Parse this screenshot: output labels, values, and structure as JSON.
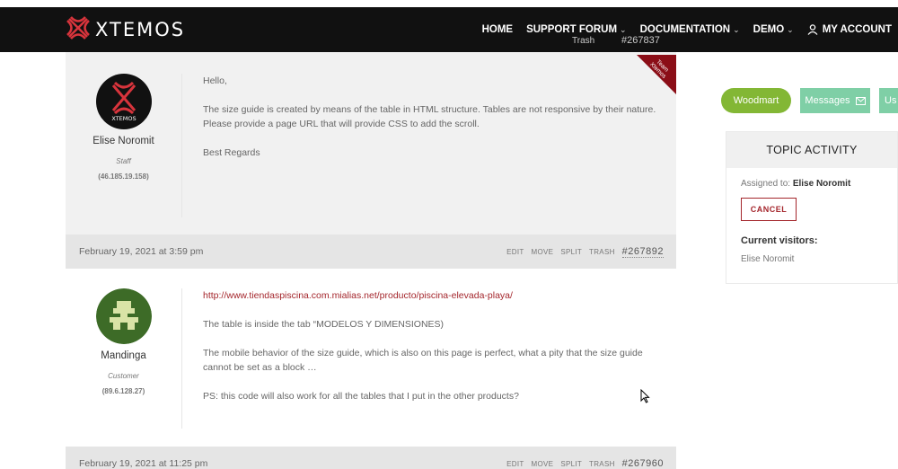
{
  "header": {
    "logo_text": "XTEMOS",
    "nav": [
      {
        "label": "HOME",
        "dropdown": false
      },
      {
        "label": "SUPPORT FORUM",
        "dropdown": true
      },
      {
        "label": "DOCUMENTATION",
        "dropdown": true
      },
      {
        "label": "DEMO",
        "dropdown": true
      }
    ],
    "account_label": "MY ACCOUNT"
  },
  "ghost_bar": {
    "actions": "Trash",
    "permalink": "#267837"
  },
  "posts": [
    {
      "author": {
        "name": "Elise Noromit",
        "role": "Staff",
        "ip": "(46.185.19.158)",
        "avatar_text": "XTEMOS"
      },
      "ribbon": "Team Xtemos",
      "paragraphs": [
        "Hello,",
        "The size guide is created by means of the table in HTML structure. Tables are not responsive by their nature. Please provide a page URL that will provide CSS to add the scroll.",
        "Best Regards"
      ]
    },
    {
      "date": "February 19, 2021 at 3:59 pm",
      "actions": [
        "EDIT",
        "MOVE",
        "SPLIT",
        "TRASH"
      ],
      "permalink": "#267892",
      "author": {
        "name": "Mandinga",
        "role": "Customer",
        "ip": "(89.6.128.27)"
      },
      "link": "http://www.tiendaspiscina.com.mialias.net/producto/piscina-elevada-playa/",
      "paragraphs": [
        "The table is inside the tab “MODELOS Y DIMENSIONES)",
        "The mobile behavior of the size guide, which is also on this page is perfect, what a pity that the size guide cannot be set as a block …",
        "PS: this code will also work for all the tables that I put in the other products?"
      ]
    },
    {
      "date": "February 19, 2021 at 11:25 pm",
      "actions": [
        "EDIT",
        "MOVE",
        "SPLIT",
        "TRASH"
      ],
      "permalink": "#267960"
    }
  ],
  "sidebar": {
    "tabs": [
      "Woodmart",
      "Messages",
      "Us"
    ],
    "activity": {
      "title": "TOPIC ACTIVITY",
      "assigned_label": "Assigned to:",
      "assigned_name": "Elise Noromit",
      "cancel_label": "CANCEL",
      "visitors_title": "Current visitors:",
      "visitors": [
        "Elise Noromit"
      ]
    }
  },
  "colors": {
    "accent": "#a4262c",
    "green": "#83b735",
    "mint": "#7fcfa6",
    "header": "#111111"
  }
}
